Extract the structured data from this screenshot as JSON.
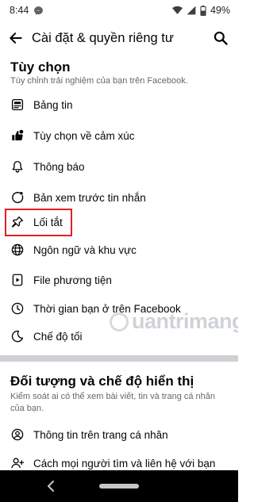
{
  "status_bar": {
    "time": "8:44",
    "battery": "49%"
  },
  "header": {
    "title": "Cài đặt & quyền riêng tư"
  },
  "section_preferences": {
    "title": "Tùy chọn",
    "description": "Tùy chỉnh trải nghiệm của bạn trên Facebook."
  },
  "items": [
    {
      "label": "Bảng tin",
      "icon": "news-feed-icon"
    },
    {
      "label": "Tùy chọn về cảm xúc",
      "icon": "reaction-icon"
    },
    {
      "label": "Thông báo",
      "icon": "bell-icon"
    },
    {
      "label": "Bản xem trước tin nhắn",
      "icon": "message-preview-icon"
    },
    {
      "label": "Lối tắt",
      "icon": "pin-icon"
    },
    {
      "label": "Ngôn ngữ và khu vực",
      "icon": "globe-icon"
    },
    {
      "label": "File phương tiện",
      "icon": "media-file-icon"
    },
    {
      "label": "Thời gian bạn ở trên Facebook",
      "icon": "clock-icon"
    },
    {
      "label": "Chế độ tối",
      "icon": "moon-icon"
    }
  ],
  "section_audience": {
    "title": "Đối tượng và chế độ hiển thị",
    "description": "Kiểm soát ai có thể xem bài viết, tin và trang cá nhân của bạn."
  },
  "items_audience": [
    {
      "label": "Thông tin trên trang cá nhân",
      "icon": "profile-icon"
    },
    {
      "label": "Cách mọi người tìm và liên hệ với bạn",
      "icon": "add-friend-icon"
    }
  ],
  "watermark": {
    "text": "uantrimang"
  },
  "colors": {
    "highlight": "#e41e25",
    "text": "#050505",
    "secondary_text": "#65676b",
    "divider": "#ced0d4"
  }
}
